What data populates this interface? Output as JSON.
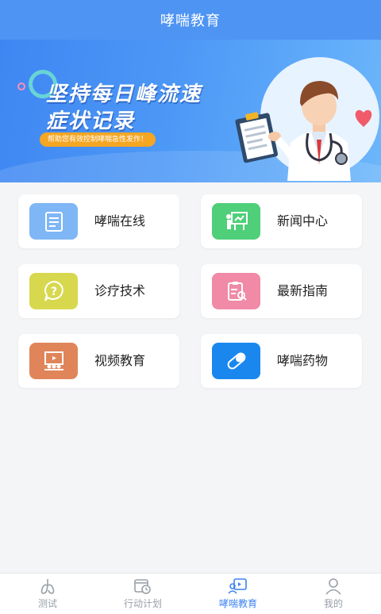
{
  "header": {
    "title": "哮喘教育"
  },
  "banner": {
    "title_line1": "坚持每日峰流速",
    "title_line2": "症状记录",
    "slogan": "帮助您有效控制哮喘急性发作！",
    "dots": 4,
    "active_dot": 2
  },
  "cards": [
    {
      "label": "哮喘在线",
      "icon": "document-icon",
      "color": "#7fb6f5"
    },
    {
      "label": "新闻中心",
      "icon": "presentation-icon",
      "color": "#4fcf7a"
    },
    {
      "label": "诊疗技术",
      "icon": "question-bubble-icon",
      "color": "#d8d84f"
    },
    {
      "label": "最新指南",
      "icon": "clipboard-search-icon",
      "color": "#f08aa6"
    },
    {
      "label": "视频教育",
      "icon": "video-lesson-icon",
      "color": "#e0855a"
    },
    {
      "label": "哮喘药物",
      "icon": "pill-icon",
      "color": "#1a87ef"
    }
  ],
  "tabs": [
    {
      "label": "测试",
      "icon": "lungs-icon",
      "active": false
    },
    {
      "label": "行动计划",
      "icon": "calendar-clock-icon",
      "active": false
    },
    {
      "label": "哮喘教育",
      "icon": "education-icon",
      "active": true
    },
    {
      "label": "我的",
      "icon": "user-icon",
      "active": false
    }
  ],
  "colors": {
    "primary": "#4e94f3",
    "active_tab": "#3b82f0",
    "inactive_tab": "#9aa0a8"
  }
}
